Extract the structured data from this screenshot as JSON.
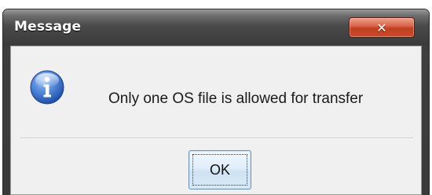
{
  "window": {
    "title": "Message",
    "close_glyph": "✕"
  },
  "message": {
    "icon": "info-icon",
    "text": "Only one OS file is allowed for transfer"
  },
  "buttons": {
    "ok_label": "OK"
  },
  "colors": {
    "titlebar_dark": "#3a3a3a",
    "close_red": "#c94a2a",
    "info_blue": "#2f66c4",
    "content_bg": "#f0f0f0"
  }
}
